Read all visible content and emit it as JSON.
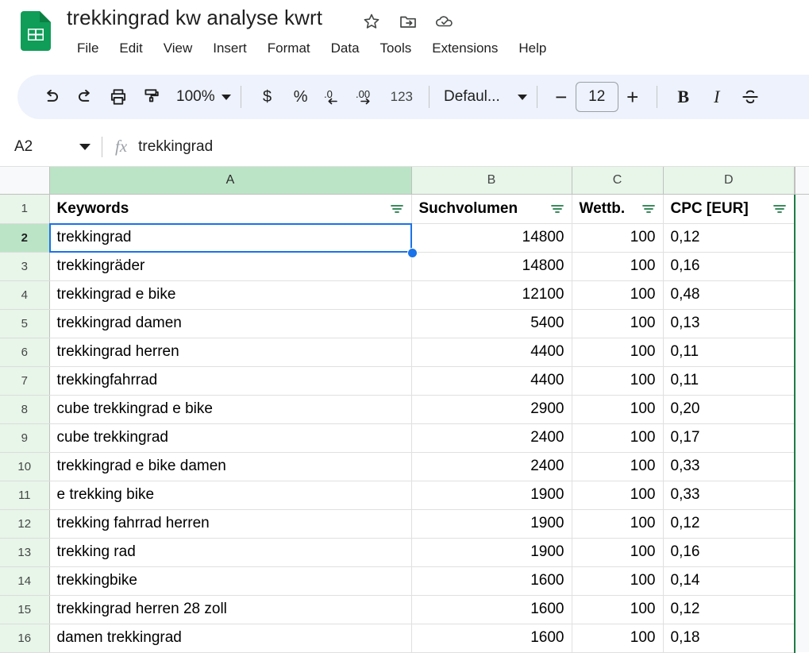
{
  "app": {
    "logo_icon": "google-sheets-logo",
    "doc_title": "trekkingrad kw analyse kwrt",
    "title_icons": [
      {
        "name": "star-icon",
        "glyph": "star"
      },
      {
        "name": "move-to-folder-icon",
        "glyph": "folder-move"
      },
      {
        "name": "saved-to-drive-icon",
        "glyph": "cloud-check"
      }
    ],
    "menu": [
      "File",
      "Edit",
      "View",
      "Insert",
      "Format",
      "Data",
      "Tools",
      "Extensions",
      "Help"
    ]
  },
  "toolbar": {
    "undo_icon": "undo-icon",
    "redo_icon": "redo-icon",
    "print_icon": "print-icon",
    "paint_format_icon": "paint-format-icon",
    "zoom_level": "100%",
    "currency_label": "$",
    "percent_label": "%",
    "decrease_decimal_icon": "decrease-decimal-icon",
    "decrease_decimal_label": ".0",
    "increase_decimal_icon": "increase-decimal-icon",
    "increase_decimal_label": ".00",
    "more_formats_label": "123",
    "font_family": "Defaul...",
    "font_size_decrease": "−",
    "font_size": "12",
    "font_size_increase": "+",
    "bold_label": "B",
    "italic_label": "I",
    "strikethrough_icon": "strikethrough-icon"
  },
  "formula_bar": {
    "name_box": "A2",
    "fx_label": "fx",
    "formula_value": "trekkingrad"
  },
  "grid": {
    "column_headers": [
      "A",
      "B",
      "C",
      "D"
    ],
    "selected_column": "A",
    "selected_row": 2,
    "selected_cell": "A2",
    "filter_icon": "filter-icon",
    "table_headers": [
      "Keywords",
      "Suchvolumen",
      "Wettb.",
      "CPC [EUR]"
    ],
    "header_row_number": "1",
    "rows": [
      {
        "n": "2",
        "keyword": "trekkingrad",
        "suchvolumen": "14800",
        "wettb": "100",
        "cpc": "0,12"
      },
      {
        "n": "3",
        "keyword": "trekkingräder",
        "suchvolumen": "14800",
        "wettb": "100",
        "cpc": "0,16"
      },
      {
        "n": "4",
        "keyword": "trekkingrad e bike",
        "suchvolumen": "12100",
        "wettb": "100",
        "cpc": "0,48"
      },
      {
        "n": "5",
        "keyword": "trekkingrad damen",
        "suchvolumen": "5400",
        "wettb": "100",
        "cpc": "0,13"
      },
      {
        "n": "6",
        "keyword": "trekkingrad herren",
        "suchvolumen": "4400",
        "wettb": "100",
        "cpc": "0,11"
      },
      {
        "n": "7",
        "keyword": "trekkingfahrrad",
        "suchvolumen": "4400",
        "wettb": "100",
        "cpc": "0,11"
      },
      {
        "n": "8",
        "keyword": "cube trekkingrad e bike",
        "suchvolumen": "2900",
        "wettb": "100",
        "cpc": "0,20"
      },
      {
        "n": "9",
        "keyword": "cube trekkingrad",
        "suchvolumen": "2400",
        "wettb": "100",
        "cpc": "0,17"
      },
      {
        "n": "10",
        "keyword": "trekkingrad e bike damen",
        "suchvolumen": "2400",
        "wettb": "100",
        "cpc": "0,33"
      },
      {
        "n": "11",
        "keyword": "e trekking bike",
        "suchvolumen": "1900",
        "wettb": "100",
        "cpc": "0,33"
      },
      {
        "n": "12",
        "keyword": "trekking fahrrad herren",
        "suchvolumen": "1900",
        "wettb": "100",
        "cpc": "0,12"
      },
      {
        "n": "13",
        "keyword": "trekking rad",
        "suchvolumen": "1900",
        "wettb": "100",
        "cpc": "0,16"
      },
      {
        "n": "14",
        "keyword": "trekkingbike",
        "suchvolumen": "1600",
        "wettb": "100",
        "cpc": "0,14"
      },
      {
        "n": "15",
        "keyword": "trekkingrad herren 28 zoll",
        "suchvolumen": "1600",
        "wettb": "100",
        "cpc": "0,12"
      },
      {
        "n": "16",
        "keyword": "damen trekkingrad",
        "suchvolumen": "1600",
        "wettb": "100",
        "cpc": "0,18"
      }
    ]
  },
  "colors": {
    "sheets_green": "#0f9d58",
    "header_green_selected": "#bbe4c6",
    "header_green": "#e8f5e9",
    "selection_blue": "#1a73e8",
    "toolbar_bg": "#edf2fc",
    "filter_green": "#1e7b45",
    "table_range_border": "#1e7b45"
  }
}
